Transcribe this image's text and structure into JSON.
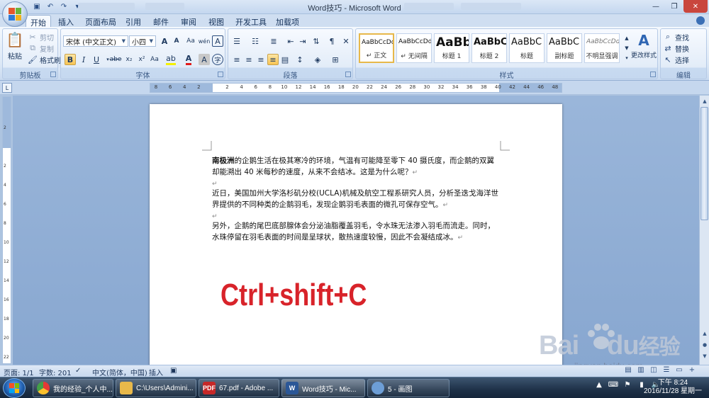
{
  "window": {
    "title": "Word技巧 - Microsoft Word"
  },
  "ribbon_tabs": [
    "开始",
    "插入",
    "页面布局",
    "引用",
    "邮件",
    "审阅",
    "视图",
    "开发工具",
    "加载项"
  ],
  "clipboard": {
    "paste_label": "粘贴",
    "cut_label": "剪切",
    "copy_label": "复制",
    "format_painter_label": "格式刷",
    "group_label": "剪贴板"
  },
  "font": {
    "font_name": "宋体 (中文正文)",
    "font_size": "小四",
    "group_label": "字体",
    "bold": "B",
    "italic": "I",
    "underline": "U",
    "strike": "abe",
    "subscript": "x₂",
    "superscript": "x²",
    "aa_grow": "A",
    "aa_shrink": "A",
    "wen": "wén",
    "char_border": "A",
    "clear_format": "Aa",
    "font_color": "A",
    "char_shade": "A",
    "enclose": "字"
  },
  "paragraph": {
    "group_label": "段落"
  },
  "styles": {
    "group_label": "样式",
    "items": [
      {
        "sample": "AaBbCcDd",
        "name": "↵ 正文"
      },
      {
        "sample": "AaBbCcDd",
        "name": "↵ 无间隔"
      },
      {
        "sample": "AaBb",
        "name": "标题 1"
      },
      {
        "sample": "AaBbC",
        "name": "标题 2"
      },
      {
        "sample": "AaBbC",
        "name": "标题"
      },
      {
        "sample": "AaBbC",
        "name": "副标题"
      },
      {
        "sample": "AaBbCcDd",
        "name": "不明显强调"
      }
    ],
    "change_styles_label": "更改样式"
  },
  "editing": {
    "group_label": "编辑",
    "find_label": "查找",
    "replace_label": "替换",
    "select_label": "选择"
  },
  "ruler": {
    "ticks": [
      "8",
      "6",
      "4",
      "2",
      "",
      "2",
      "4",
      "6",
      "8",
      "10",
      "12",
      "14",
      "16",
      "18",
      "20",
      "22",
      "24",
      "26",
      "28",
      "30",
      "32",
      "34",
      "36",
      "38",
      "40",
      "42",
      "44",
      "46",
      "48"
    ],
    "vticks": [
      "2",
      "",
      "2",
      "4",
      "6",
      "8",
      "10",
      "12",
      "14",
      "16",
      "18",
      "20",
      "22"
    ]
  },
  "document": {
    "p1_bold": "南极洲",
    "p1_rest": "的企鹅生活在极其寒冷的环境，气温有可能降至零下 40 摄氏度，而企鹅的双翼却能溯出 40 米每秒的速度，从来不会结冰。这是为什么呢？",
    "p2": "近日，美国加州大学洛杉矶分校(UCLA)机械及航空工程系研究人员，分析圣迭戈海洋世界提供的不同种类的企鹅羽毛，发现企鹅羽毛表面的微孔可保存空气。",
    "p3": "另外，企鹅的尾巴底部腺体会分泌油脂覆盖羽毛，令水珠无法渗入羽毛而流走。同时，水珠停留在羽毛表面的时间是呈球状，散热速度较慢，因此不会凝结成冰。",
    "para_mark": "↵",
    "shortcut": "Ctrl+shift+C"
  },
  "statusbar": {
    "page": "页面: 1/1",
    "words": "字数: 201",
    "language": "中文(简体，中国)",
    "mode": "插入"
  },
  "watermark": {
    "brand": "Bai",
    "brand2": "du",
    "brand_cn": "经验",
    "url": "jingyan.baidu.com"
  },
  "taskbar": {
    "items": [
      {
        "label": "我的经验_个人中...",
        "icon": "chrome"
      },
      {
        "label": "C:\\Users\\Admini...",
        "icon": "folder"
      },
      {
        "label": "67.pdf - Adobe ...",
        "icon": "pdf"
      },
      {
        "label": "Word技巧 - Mic...",
        "icon": "word"
      },
      {
        "label": "5 - 画图",
        "icon": "paint"
      }
    ],
    "time": "下午 8:24",
    "date": "2016/11/28 星期一"
  },
  "colors": {
    "accent_red": "#d8232a",
    "ribbon_blue": "#dce8f6",
    "taskbar": "#1e3148"
  }
}
